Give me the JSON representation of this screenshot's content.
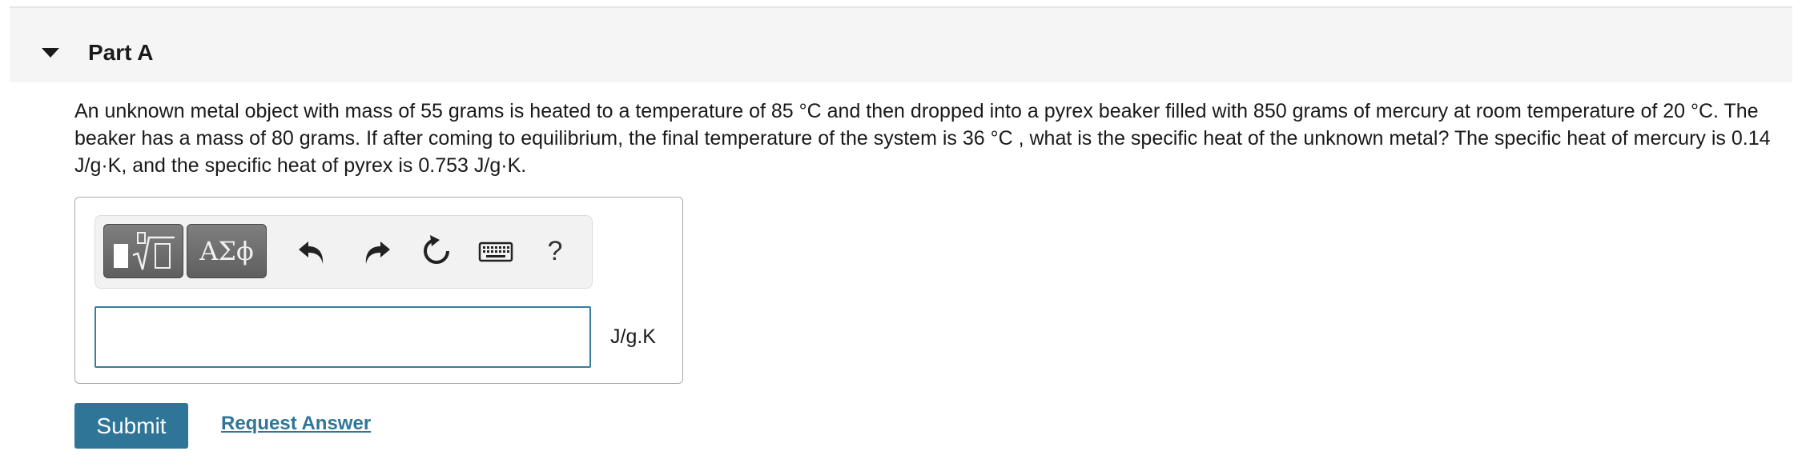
{
  "part": {
    "title": "Part A",
    "expanded": true,
    "caret_icon": "caret-down-icon"
  },
  "question": {
    "text": "An unknown metal object with mass of 55 grams is heated to a temperature of 85 °C and then dropped into a pyrex beaker filled with 850 grams of mercury at room temperature of 20 °C.  The beaker has a mass of 80 grams.  If after coming to equilibrium, the final temperature of the system is 36 °C , what is the specific heat of the unknown metal? The specific heat of mercury is 0.14 J/g·K, and the specific heat of pyrex is 0.753 J/g·K."
  },
  "toolbar": {
    "templates_icon": "templates-radical-icon",
    "greek_label": "ΑΣϕ",
    "undo_icon": "undo-icon",
    "redo_icon": "redo-icon",
    "reset_icon": "reset-icon",
    "keyboard_icon": "keyboard-icon",
    "help_label": "?"
  },
  "answer": {
    "value": "",
    "unit": "J/g.K"
  },
  "actions": {
    "submit_label": "Submit",
    "request_answer_label": "Request Answer"
  },
  "colors": {
    "accent": "#2f7597",
    "input_border": "#3a7c9a",
    "header_bg": "#f5f5f5",
    "toolbar_button": "#6f6f6f"
  }
}
